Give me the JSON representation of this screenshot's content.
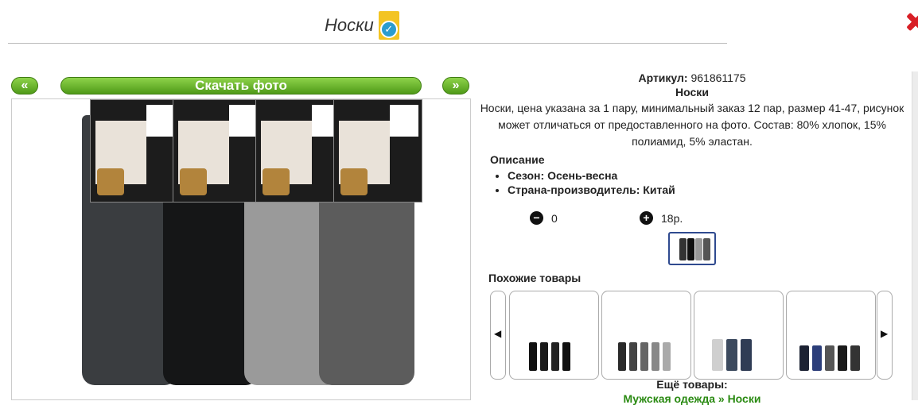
{
  "header": {
    "title": "Носки"
  },
  "gallery": {
    "prev_label": "«",
    "download_label": "Скачать фото",
    "next_label": "»"
  },
  "product": {
    "article_label": "Артикул:",
    "article_value": "961861175",
    "name": "Носки",
    "description": "Носки, цена указана за 1 пару, минимальный заказ 12 пар, размер 41-47, рисунок может отличаться от предоставленного на фото. Состав: 80% хлопок, 15% полиамид, 5% эластан.",
    "section_title": "Описание",
    "properties": [
      "Сезон: Осень-весна",
      "Страна-производитель: Китай"
    ],
    "quantity": "0",
    "price": "18р."
  },
  "similar": {
    "title": "Похожие товары",
    "more_label": "Ещё товары:",
    "breadcrumb": "Мужская одежда » Носки"
  },
  "colors": {
    "accent_green": "#4f9a18",
    "close_red": "#d81f26",
    "link_green": "#2a8a12",
    "selected_border": "#2f4a8f"
  },
  "icons": {
    "close": "close-icon",
    "verified": "verified-badge-icon",
    "minus": "minus-circle-icon",
    "plus": "plus-circle-icon",
    "left": "carousel-left-icon",
    "right": "carousel-right-icon"
  }
}
